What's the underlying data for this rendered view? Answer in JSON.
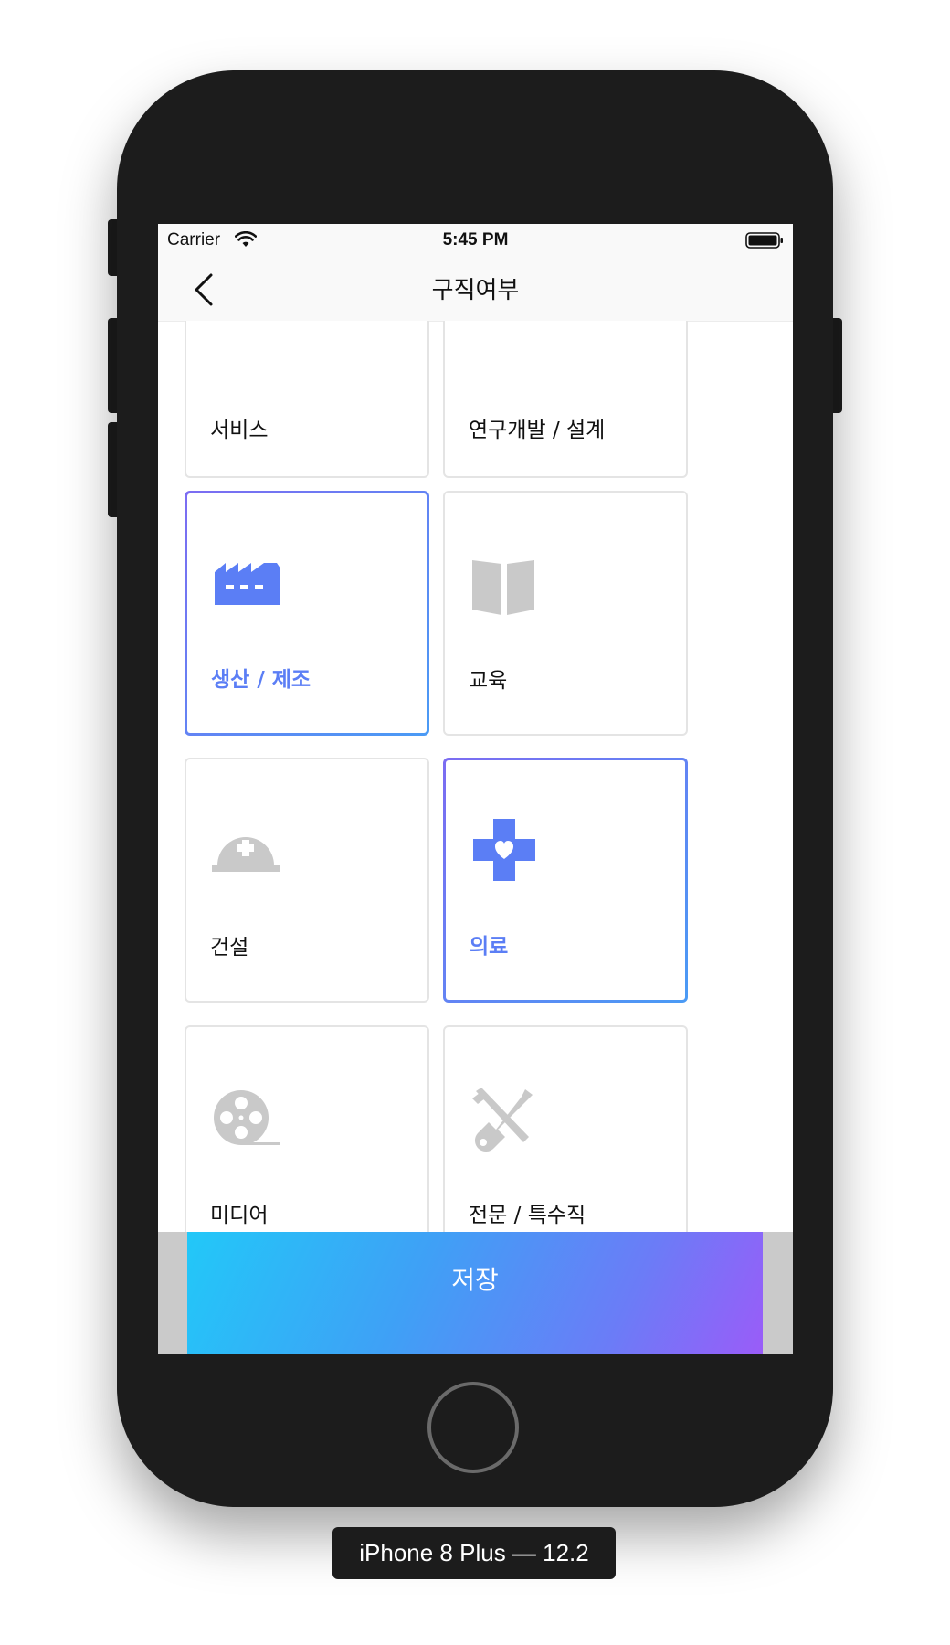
{
  "status_bar": {
    "carrier": "Carrier",
    "time": "5:45 PM",
    "wifi_icon": "wifi-icon",
    "battery_icon": "battery-full-icon"
  },
  "nav": {
    "back_icon": "chevron-left-icon",
    "title": "구직여부"
  },
  "categories": [
    {
      "label": "서비스",
      "icon": "service-icon",
      "selected": false
    },
    {
      "label": "연구개발 / 설계",
      "icon": "research-icon",
      "selected": false
    },
    {
      "label": "생산 / 제조",
      "icon": "factory-icon",
      "selected": true
    },
    {
      "label": "교육",
      "icon": "book-icon",
      "selected": false
    },
    {
      "label": "건설",
      "icon": "hard-hat-icon",
      "selected": false
    },
    {
      "label": "의료",
      "icon": "medical-cross-icon",
      "selected": true
    },
    {
      "label": "미디어",
      "icon": "film-reel-icon",
      "selected": false
    },
    {
      "label": "전문 / 특수직",
      "icon": "tools-icon",
      "selected": false
    }
  ],
  "save_button": {
    "label": "저장"
  },
  "colors": {
    "accent": "#5b7ef5",
    "icon_inactive": "#c9c9c9",
    "gradient_start": "#22c8f8",
    "gradient_end": "#9a5cf8"
  },
  "device_label": "iPhone 8 Plus — 12.2"
}
